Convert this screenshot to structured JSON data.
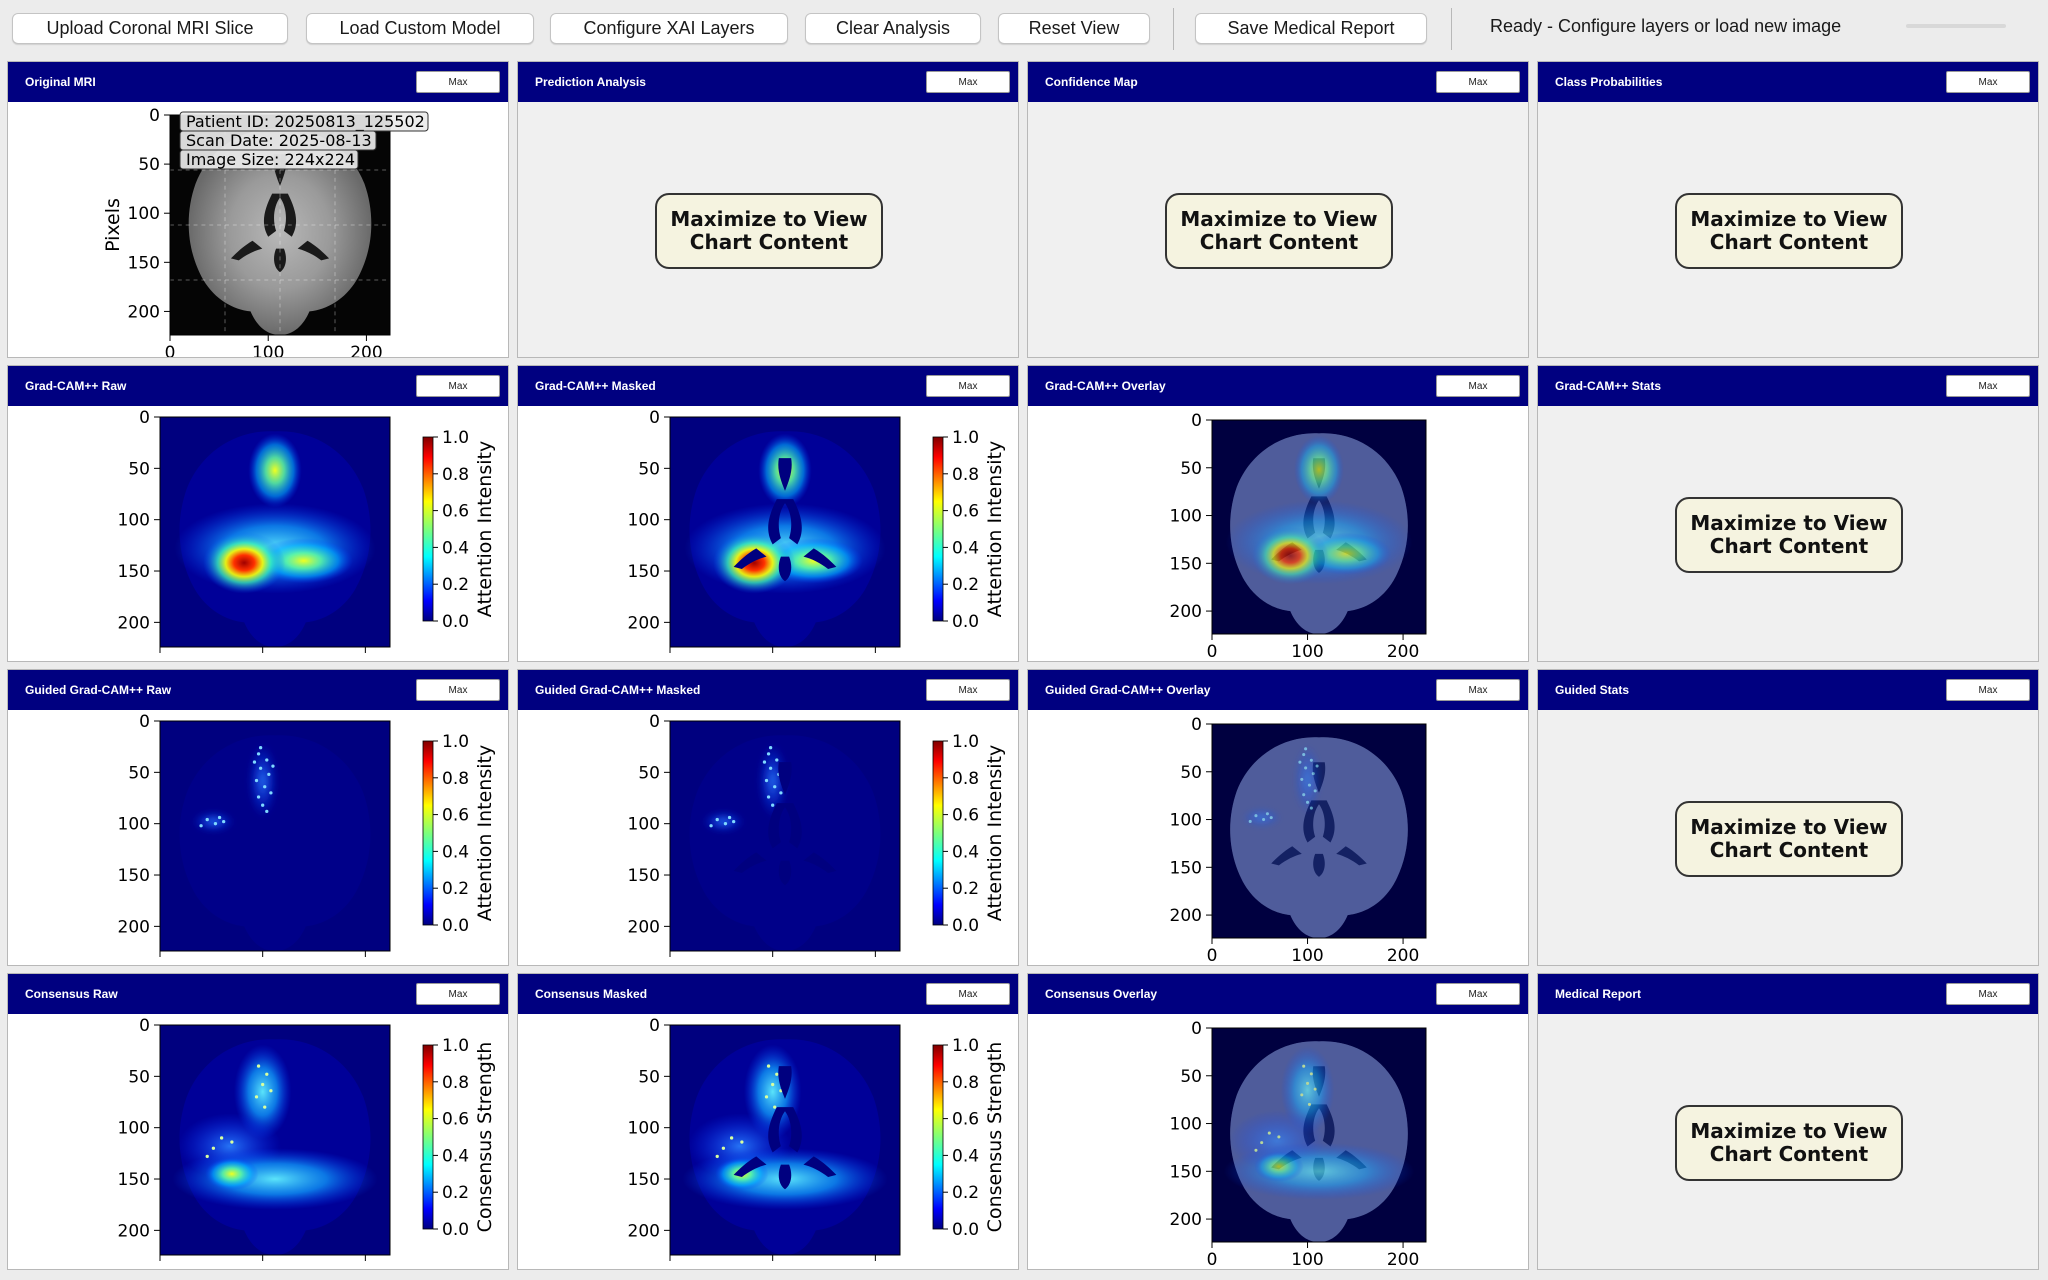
{
  "toolbar": {
    "buttons": [
      {
        "label": "Upload Coronal MRI Slice"
      },
      {
        "label": "Load Custom Model"
      },
      {
        "label": "Configure XAI Layers"
      },
      {
        "label": "Clear Analysis"
      },
      {
        "label": "Reset View"
      },
      {
        "label": "Save Medical Report"
      }
    ],
    "status": "Ready - Configure layers or load new image",
    "progress": 0
  },
  "common": {
    "max_label": "Max",
    "maximize_message": "Maximize to View\nChart Content",
    "y_ticks": [
      "0",
      "50",
      "100",
      "150",
      "200"
    ],
    "x_ticks": [
      "0",
      "100",
      "200"
    ],
    "cbar_ticks": [
      "0.0",
      "0.2",
      "0.4",
      "0.6",
      "0.8",
      "1.0"
    ]
  },
  "panels": [
    {
      "title": "Original MRI",
      "kind": "mri",
      "ylabel": "Pixels",
      "annotation": [
        "Patient ID: 20250813_125502",
        "Scan Date: 2025-08-13",
        "Image Size: 224x224"
      ]
    },
    {
      "title": "Prediction Analysis",
      "kind": "placeholder"
    },
    {
      "title": "Confidence Map",
      "kind": "placeholder"
    },
    {
      "title": "Class Probabilities",
      "kind": "placeholder"
    },
    {
      "title": "Grad-CAM++ Raw",
      "kind": "heat",
      "map": "gradcam",
      "masked": false,
      "cbar_label": "Attention Intensity"
    },
    {
      "title": "Grad-CAM++ Masked",
      "kind": "heat",
      "map": "gradcam",
      "masked": true,
      "cbar_label": "Attention Intensity"
    },
    {
      "title": "Grad-CAM++ Overlay",
      "kind": "overlay",
      "map": "gradcam"
    },
    {
      "title": "Grad-CAM++ Stats",
      "kind": "placeholder"
    },
    {
      "title": "Guided Grad-CAM++ Raw",
      "kind": "heat",
      "map": "guided",
      "masked": false,
      "cbar_label": "Attention Intensity"
    },
    {
      "title": "Guided Grad-CAM++ Masked",
      "kind": "heat",
      "map": "guided",
      "masked": true,
      "cbar_label": "Attention Intensity"
    },
    {
      "title": "Guided Grad-CAM++ Overlay",
      "kind": "overlay",
      "map": "guided"
    },
    {
      "title": "Guided Stats",
      "kind": "placeholder"
    },
    {
      "title": "Consensus Raw",
      "kind": "heat",
      "map": "consensus",
      "masked": false,
      "cbar_label": "Consensus Strength"
    },
    {
      "title": "Consensus Masked",
      "kind": "heat",
      "map": "consensus",
      "masked": true,
      "cbar_label": "Consensus Strength"
    },
    {
      "title": "Consensus Overlay",
      "kind": "overlay",
      "map": "consensus"
    },
    {
      "title": "Medical Report",
      "kind": "placeholder"
    }
  ]
}
